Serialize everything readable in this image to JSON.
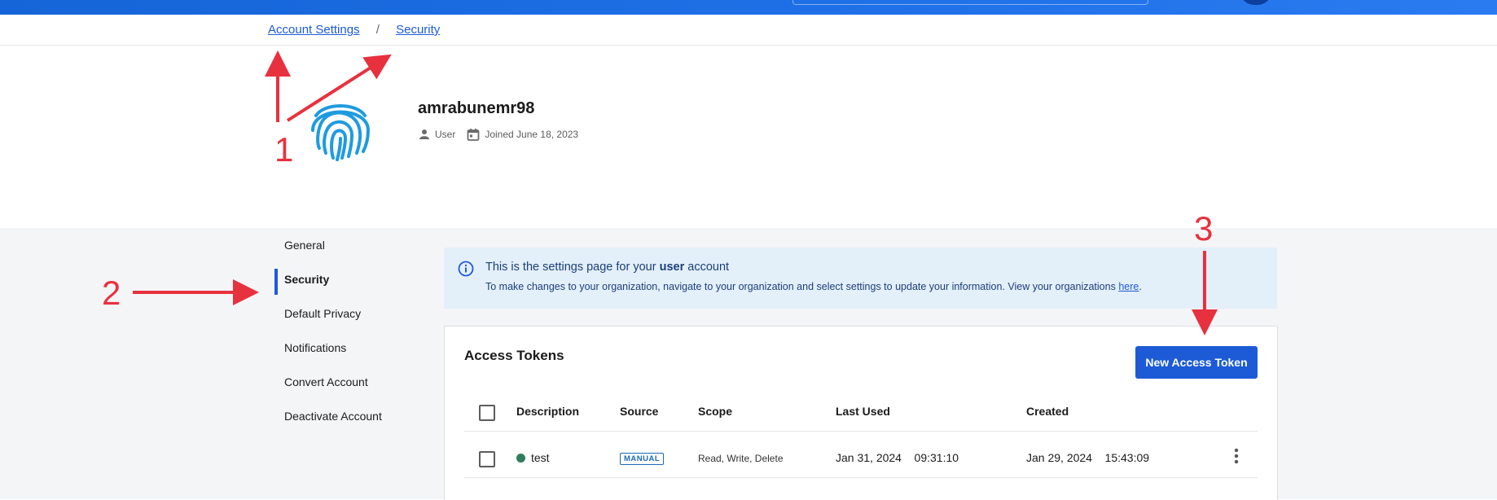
{
  "breadcrumb": {
    "parent": "Account Settings",
    "separator": "/",
    "current": "Security"
  },
  "profile": {
    "username": "amrabunemr98",
    "role": "User",
    "joined": "Joined June 18, 2023"
  },
  "sidebar": {
    "items": [
      {
        "label": "General"
      },
      {
        "label": "Security"
      },
      {
        "label": "Default Privacy"
      },
      {
        "label": "Notifications"
      },
      {
        "label": "Convert Account"
      },
      {
        "label": "Deactivate Account"
      }
    ],
    "active": "Security"
  },
  "banner": {
    "line1_prefix": "This is the settings page for your",
    "line1_bold": "user",
    "line1_suffix": "account",
    "line2_text": "To make changes to your organization, navigate to your organization and select settings to update your information. View your organizations",
    "line2_link": "here",
    "line2_end": "."
  },
  "tokens": {
    "title": "Access Tokens",
    "new_button": "New Access Token",
    "columns": [
      "Description",
      "Source",
      "Scope",
      "Last Used",
      "Created"
    ],
    "rows": [
      {
        "description": "test",
        "source": "MANUAL",
        "scope": "Read, Write, Delete",
        "last_used_date": "Jan 31, 2024",
        "last_used_time": "09:31:10",
        "created_date": "Jan 29, 2024",
        "created_time": "15:43:09"
      }
    ]
  },
  "annotations": {
    "n1": "1",
    "n2": "2",
    "n3": "3"
  },
  "colors": {
    "accent": "#1d5bd6",
    "annotation": "#e8313e",
    "status_active": "#2e7d5b",
    "banner_bg": "#e3eff9"
  }
}
